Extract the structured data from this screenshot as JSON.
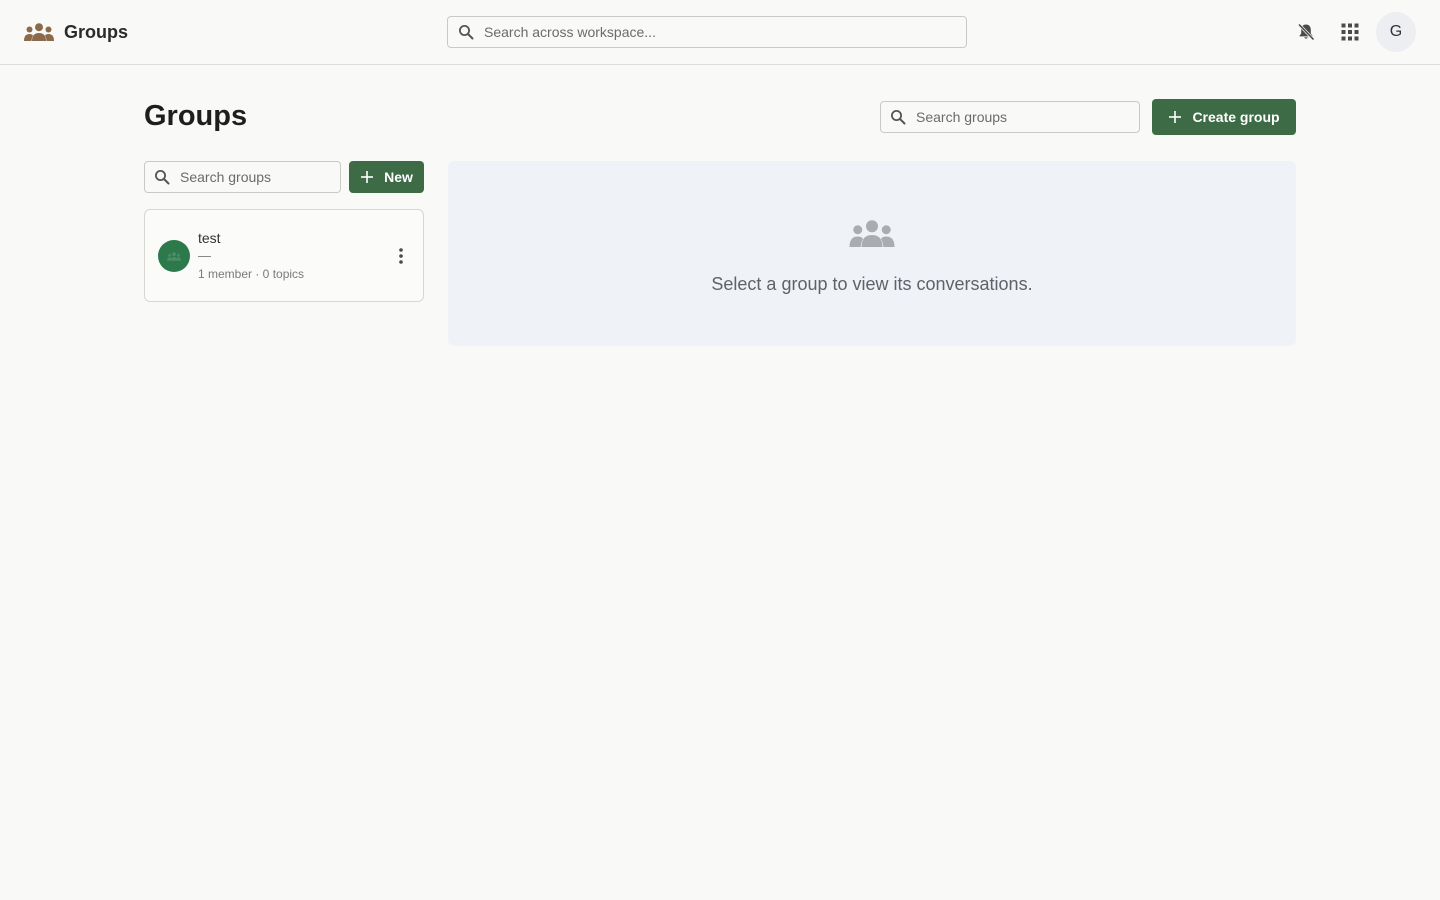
{
  "app": {
    "title": "Groups"
  },
  "topbar": {
    "search_placeholder": "Search across workspace...",
    "avatar_initial": "G"
  },
  "page": {
    "title": "Groups",
    "search_placeholder": "Search groups",
    "create_label": "Create group"
  },
  "list": {
    "search_placeholder": "Search groups",
    "new_label": "New",
    "groups": [
      {
        "name": "test",
        "description": "—",
        "meta": "1 member · 0 topics"
      }
    ]
  },
  "empty_state": {
    "message": "Select a group to view its conversations."
  },
  "colors": {
    "primary": "#3d6b45",
    "brand_icon": "#8a6a4a",
    "group_avatar": "#2c7a4b",
    "background": "#f9faf7",
    "panel": "#eff2f7"
  },
  "icons": {
    "brand": "groups-icon",
    "search": "search-icon",
    "bell": "bell-off-icon",
    "apps": "apps-grid-icon",
    "plus": "plus-icon",
    "more": "more-vertical-icon"
  }
}
